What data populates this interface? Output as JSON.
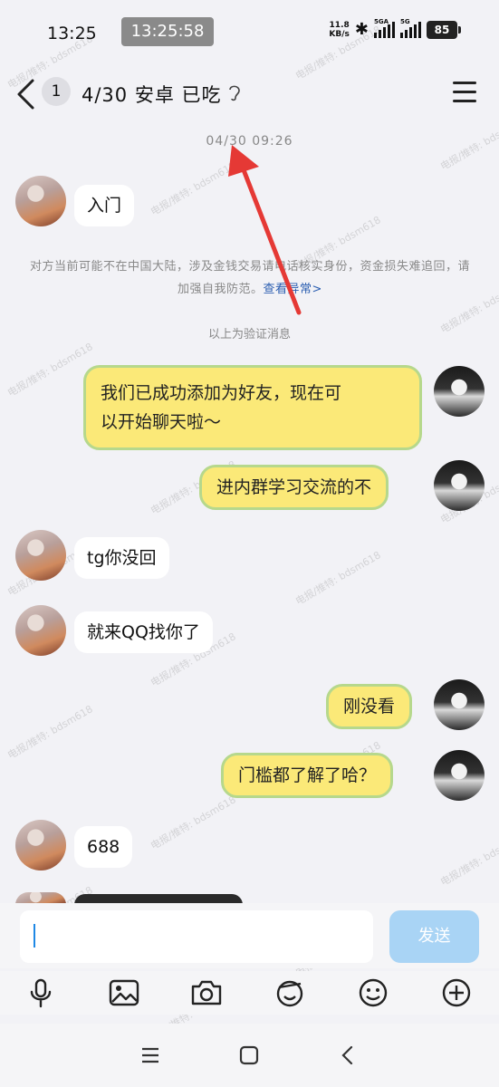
{
  "status_bar": {
    "time": "13:25",
    "clock_overlay": "13:25:58",
    "net_speed_value": "11.8",
    "net_speed_unit": "KB/s",
    "signal1_label": "5GA",
    "signal2_label": "5G",
    "battery": "85"
  },
  "header": {
    "unread_count": "1",
    "title": "4/30 安卓 已吃"
  },
  "chat": {
    "timestamp": "04/30 09:26",
    "notice_text": "对方当前可能不在中国大陆，涉及金钱交易请电话核实身份，资金损失难追回，请加强自我防范。",
    "notice_link": "查看异常>",
    "verify_text": "以上为验证消息",
    "messages": [
      {
        "side": "left",
        "text": "入门"
      },
      {
        "side": "right",
        "text": "我们已成功添加为好友，现在可",
        "text2": "以开始聊天啦～"
      },
      {
        "side": "right",
        "text": "进内群学习交流的不"
      },
      {
        "side": "left",
        "text": "tg你没回"
      },
      {
        "side": "left",
        "text": "就来QQ找你了"
      },
      {
        "side": "right",
        "text": "刚没看"
      },
      {
        "side": "right",
        "text": "门槛都了解了哈？"
      },
      {
        "side": "left",
        "text": "688"
      }
    ]
  },
  "composer": {
    "input_value": "",
    "send_label": "发送"
  },
  "icons": {
    "tools": [
      "microphone-icon",
      "image-icon",
      "camera-icon",
      "sticker-icon",
      "emoji-icon",
      "plus-icon"
    ],
    "nav": [
      "menu-icon",
      "home-icon",
      "back-icon"
    ]
  },
  "watermark": "电报/推特: bdsm618",
  "colors": {
    "yellow_bubble": "#fbe978",
    "bubble_border": "#b6d88c",
    "send_button": "#a9d4f5",
    "link": "#2a5db0",
    "arrow": "#e53935"
  }
}
